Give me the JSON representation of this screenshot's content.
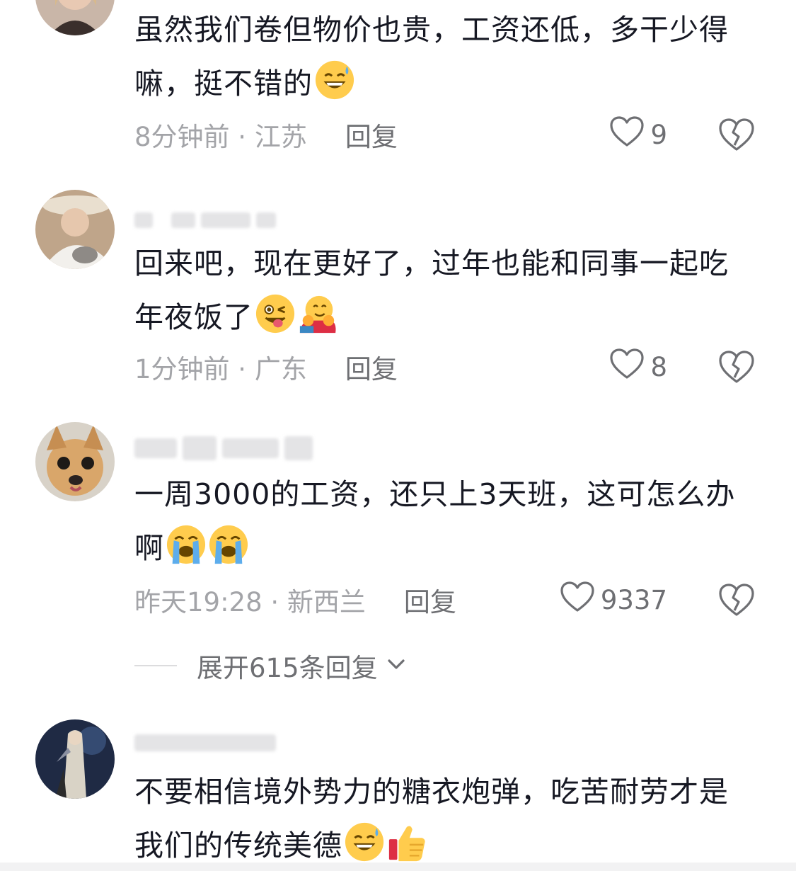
{
  "comments": [
    {
      "text": "虽然我们卷但物价也贵，工资还低，多干少得嘛，挺不错的",
      "time": "8分钟前 · 江苏",
      "reply": "回复",
      "likes": "9",
      "emojis": [
        "grin-sweat"
      ]
    },
    {
      "text": "回来吧，现在更好了，过年也能和同事一起吃年夜饭了",
      "time": "1分钟前 · 广东",
      "reply": "回复",
      "likes": "8",
      "emojis": [
        "wink-tongue",
        "hug"
      ]
    },
    {
      "text": "一周3000的工资，还只上3天班，这可怎么办啊",
      "time": "昨天19:28 · 新西兰",
      "reply": "回复",
      "likes": "9337",
      "emojis": [
        "loudly-crying",
        "loudly-crying"
      ]
    },
    {
      "text": "不要相信境外势力的糖衣炮弹，吃苦耐劳才是我们的传统美德",
      "emojis": [
        "grin-sweat",
        "thumbs-up"
      ]
    }
  ],
  "expand_replies": "展开615条回复",
  "icons": {
    "like": "heart-outline-icon",
    "dislike": "broken-heart-icon",
    "expand": "chevron-down-icon"
  },
  "colors": {
    "text": "#161823",
    "meta": "#a3a4a8",
    "action": "#6e6f73"
  }
}
